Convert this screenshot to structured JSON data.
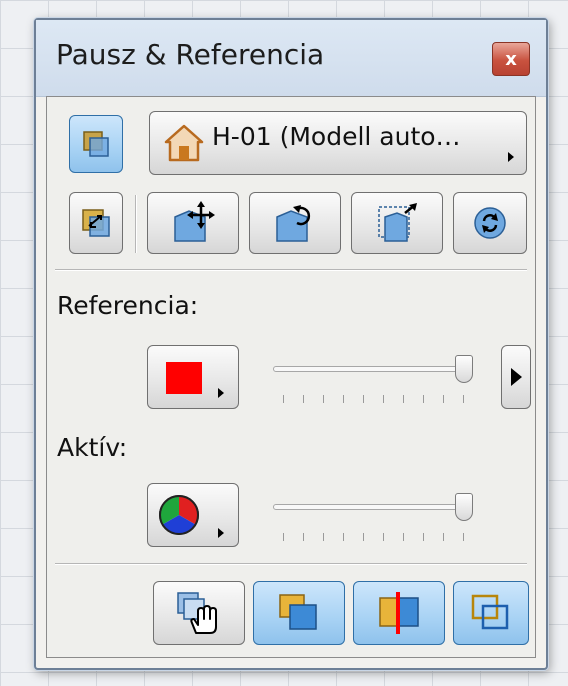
{
  "window": {
    "title": "Pausz & Referencia",
    "close_label": "x"
  },
  "reference_selector": {
    "label": "H-01 (Modell auto…",
    "icon": "house-icon"
  },
  "toolbar_row2": {
    "icons": [
      "swap-layers-icon",
      "move-icon",
      "rotate-icon",
      "scale-icon",
      "refresh-icon"
    ]
  },
  "reference": {
    "label": "Referencia:",
    "color": "#ff0000",
    "slider_value": 1.0
  },
  "active": {
    "label": "Aktív:",
    "color_icon": "rgb-wheel-icon",
    "slider_value": 1.0
  },
  "bottom_toolbar": {
    "icons": [
      "drag-hand-icon",
      "overlay-front-icon",
      "split-compare-icon",
      "outline-overlay-icon"
    ]
  },
  "colors": {
    "accent_blue": "#4a90d9",
    "pressed_fill": "#a7d2f4",
    "marker_red": "#ff0000",
    "icon_gold": "#d9b24a"
  }
}
